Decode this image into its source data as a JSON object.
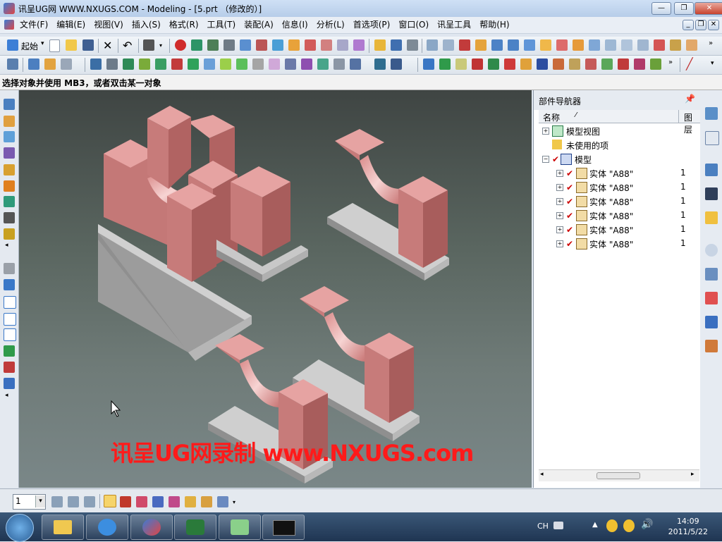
{
  "window": {
    "title": "讯呈UG网 WWW.NXUGS.COM - Modeling - [5.prt （修改的）]",
    "minimize": "—",
    "maximize": "❐",
    "close": "✕"
  },
  "menu": [
    "文件(F)",
    "编辑(E)",
    "视图(V)",
    "插入(S)",
    "格式(R)",
    "工具(T)",
    "装配(A)",
    "信息(I)",
    "分析(L)",
    "首选项(P)",
    "窗口(O)",
    "讯呈工具",
    "帮助(H)"
  ],
  "toolbar": {
    "start_label": "起始"
  },
  "status": {
    "prompt": "选择对象并使用 MB3，或者双击某一对象"
  },
  "navigator": {
    "title": "部件导航器",
    "columns": {
      "name": "名称",
      "layer": "图层"
    },
    "nodes": [
      {
        "label": "模型视图",
        "expander": "+",
        "indent": 0
      },
      {
        "label": "未使用的项",
        "expander": "",
        "indent": 0
      },
      {
        "label": "模型",
        "expander": "−",
        "indent": 0
      },
      {
        "label": "实体 \"A88\"",
        "count": "1",
        "expander": "+",
        "indent": 1
      },
      {
        "label": "实体 \"A88\"",
        "count": "1",
        "expander": "+",
        "indent": 1
      },
      {
        "label": "实体 \"A88\"",
        "count": "1",
        "expander": "+",
        "indent": 1
      },
      {
        "label": "实体 \"A88\"",
        "count": "1",
        "expander": "+",
        "indent": 1
      },
      {
        "label": "实体 \"A88\"",
        "count": "1",
        "expander": "+",
        "indent": 1
      },
      {
        "label": "实体 \"A88\"",
        "count": "1",
        "expander": "+",
        "indent": 1
      }
    ]
  },
  "viewport": {
    "watermark": "讯呈UG网录制  www.NXUGS.com"
  },
  "bottom": {
    "layer_value": "1"
  },
  "taskbar": {
    "ime": "CH",
    "time": "14:09",
    "date": "2011/5/22"
  },
  "colors": {
    "part_face": "#c77b7a",
    "part_top": "#e6a3a2",
    "base": "#c8c8c8",
    "watermark": "#ff1a1a"
  }
}
